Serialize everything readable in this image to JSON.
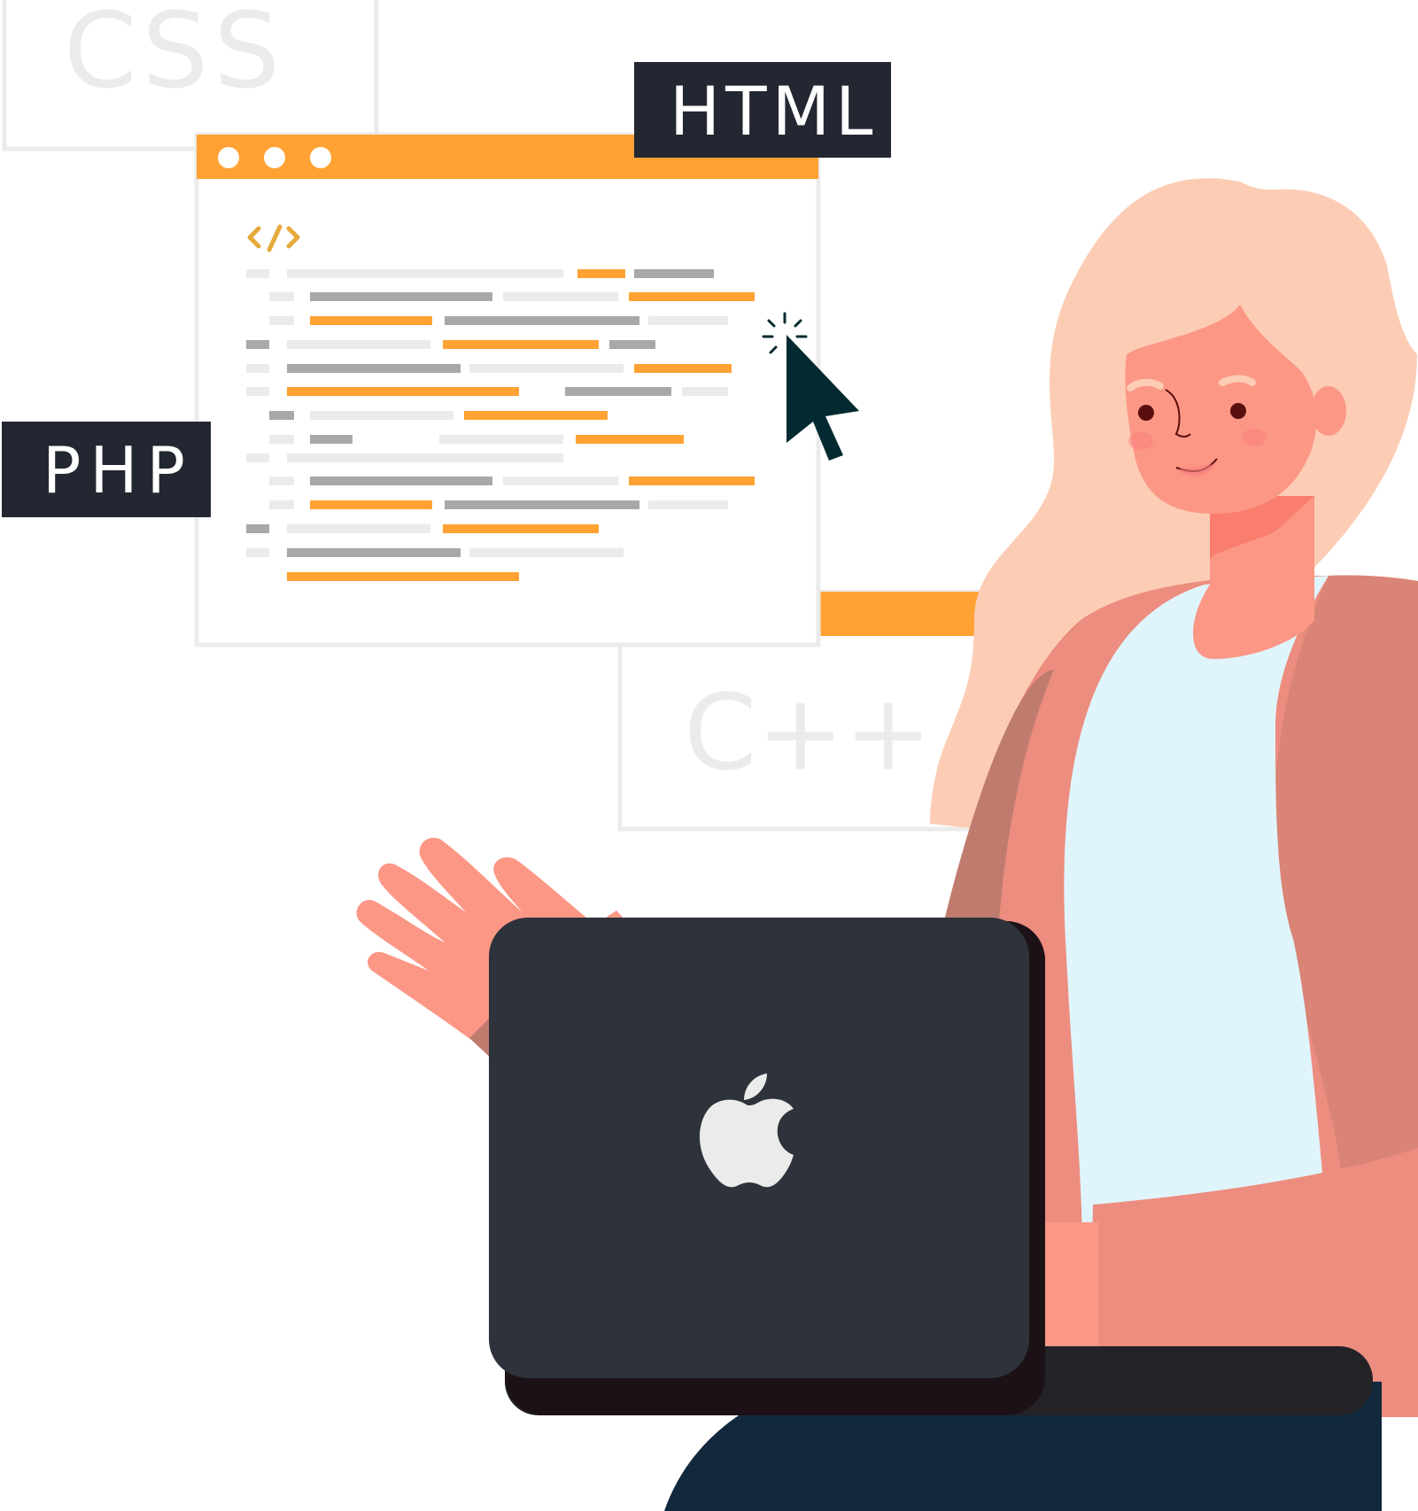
{
  "labels": {
    "css": "CSS",
    "html": "HTML",
    "php": "PHP",
    "cpp": "C++"
  },
  "editor": {
    "code_icon": "code-brackets-icon",
    "window_dots": 3
  },
  "colors": {
    "orange": "#FFA233",
    "dark_label": "#232731",
    "light_gray": "#EBEBEB",
    "mid_gray": "#A8A8A8",
    "hair": "#FCCDB4",
    "skin": "#FC9786",
    "jacket": "#EC8D7F",
    "shirt": "#E0F5FB",
    "laptop": "#2E323B",
    "pants": "#11283D",
    "cursor": "#022A30"
  },
  "icons": {
    "laptop_logo": "apple-logo-icon",
    "cursor": "mouse-pointer-icon"
  }
}
